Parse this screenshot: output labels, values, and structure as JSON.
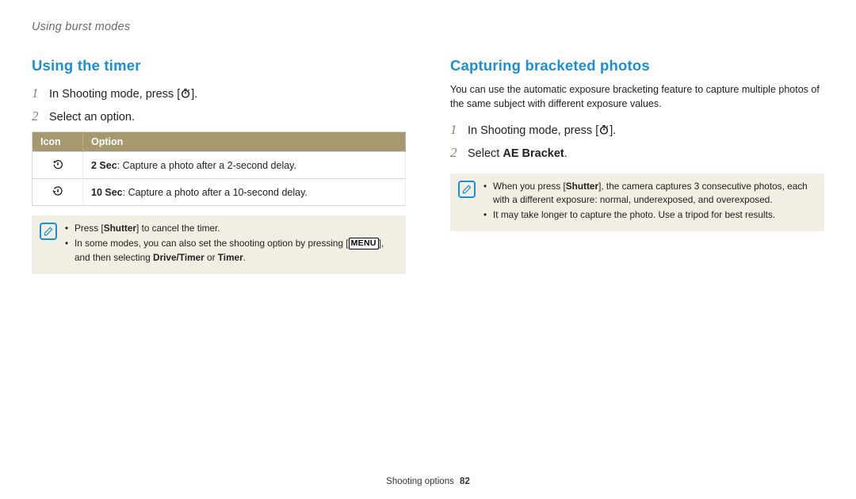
{
  "breadcrumb": "Using burst modes",
  "left": {
    "title": "Using the timer",
    "steps": [
      {
        "num": "1",
        "pre": "In Shooting mode, press ",
        "post": "."
      },
      {
        "num": "2",
        "text": "Select an option."
      }
    ],
    "table": {
      "headers": [
        "Icon",
        "Option"
      ],
      "rows": [
        {
          "bold": "2 Sec",
          "text": ": Capture a photo after a 2-second delay."
        },
        {
          "bold": "10 Sec",
          "text": ": Capture a photo after a 10-second delay."
        }
      ]
    },
    "note": [
      {
        "pre": "Press [",
        "bold1": "Shutter",
        "post": "] to cancel the timer."
      },
      {
        "pre": "In some modes, you can also set the shooting option by pressing [",
        "badge": "MENU",
        "mid": "], and then selecting ",
        "bold1": "Drive/Timer",
        "or": " or ",
        "bold2": "Timer",
        "post": "."
      }
    ]
  },
  "right": {
    "title": "Capturing bracketed photos",
    "intro": "You can use the automatic exposure bracketing feature to capture multiple photos of the same subject with different exposure values.",
    "steps": [
      {
        "num": "1",
        "pre": "In Shooting mode, press ",
        "post": "."
      },
      {
        "num": "2",
        "pre": "Select ",
        "bold": "AE Bracket",
        "post": "."
      }
    ],
    "note": [
      {
        "pre": "When you press [",
        "bold": "Shutter",
        "post": "], the camera captures 3 consecutive photos, each with a different exposure: normal, underexposed, and overexposed."
      },
      {
        "text": "It may take longer to capture the photo. Use a tripod for best results."
      }
    ]
  },
  "footer": {
    "section": "Shooting options",
    "page": "82"
  }
}
